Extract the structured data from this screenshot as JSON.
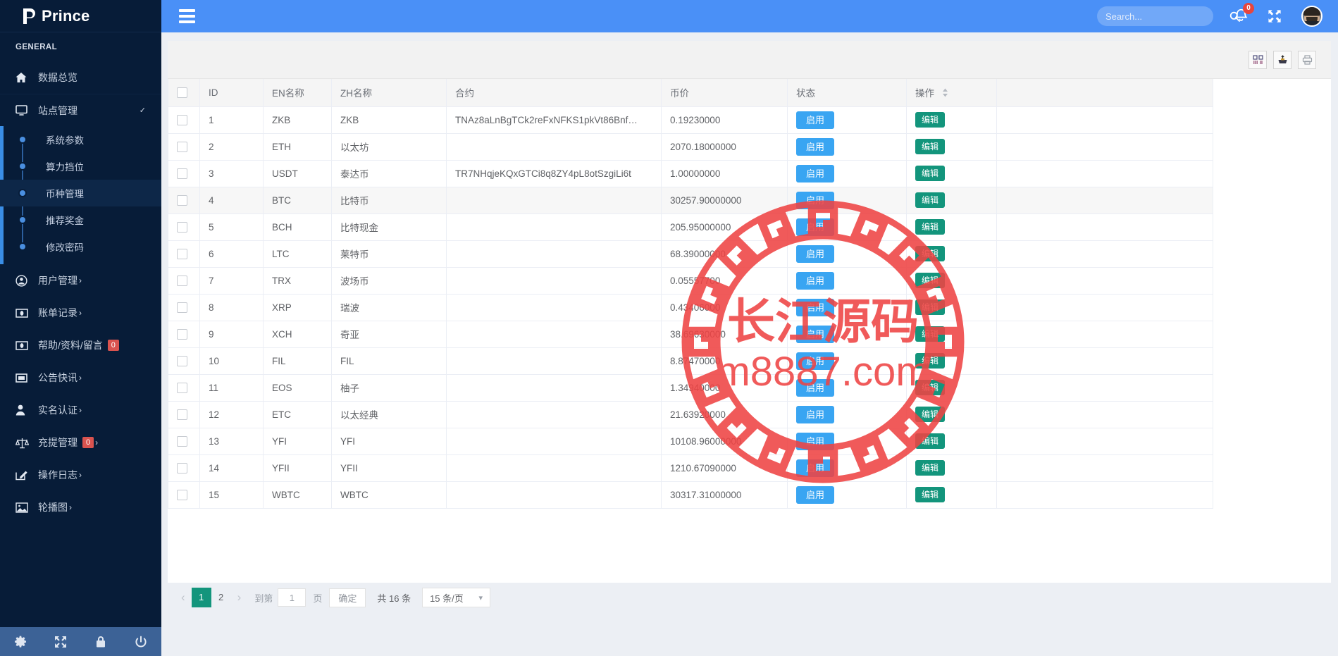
{
  "brand": {
    "name": "Prince",
    "logo_icon": "prince-p-logo"
  },
  "sidebar": {
    "section_label": "GENERAL",
    "items": [
      {
        "label": "数据总览",
        "icon": "home-icon",
        "arrow": "",
        "badge": null
      },
      {
        "label": "站点管理",
        "icon": "monitor-icon",
        "arrow": "chevron-down-icon",
        "badge": null
      }
    ],
    "submenu": [
      {
        "label": "系统参数",
        "active": false
      },
      {
        "label": "算力挡位",
        "active": false
      },
      {
        "label": "币种管理",
        "active": true
      },
      {
        "label": "推荐奖金",
        "active": false
      },
      {
        "label": "修改密码",
        "active": false
      }
    ],
    "items_after": [
      {
        "label": "用户管理",
        "icon": "user-circle-icon",
        "arrow": "›",
        "badge": null
      },
      {
        "label": "账单记录",
        "icon": "money-icon",
        "arrow": "›",
        "badge": null
      },
      {
        "label": "帮助/资料/留言",
        "icon": "money-icon",
        "arrow": "",
        "badge": "0"
      },
      {
        "label": "公告快讯",
        "icon": "window-icon",
        "arrow": "›",
        "badge": null
      },
      {
        "label": "实名认证",
        "icon": "person-icon",
        "arrow": "›",
        "badge": null
      },
      {
        "label": "充提管理",
        "icon": "scales-icon",
        "arrow": "›",
        "badge": "0"
      },
      {
        "label": "操作日志",
        "icon": "edit-square-icon",
        "arrow": "›",
        "badge": null
      },
      {
        "label": "轮播图",
        "icon": "image-icon",
        "arrow": "›",
        "badge": null
      }
    ],
    "footer_buttons": [
      {
        "name": "gear-icon"
      },
      {
        "name": "expand-icon"
      },
      {
        "name": "lock-icon"
      },
      {
        "name": "power-icon"
      }
    ]
  },
  "topbar": {
    "menu_toggle_icon": "hamburger-icon",
    "search_placeholder": "Search...",
    "search_value": "",
    "search_icon": "search-icon",
    "notification_icon": "bell-icon",
    "notification_count": "0",
    "fullscreen_icon": "expand-arrows-icon",
    "avatar_icon": "user-avatar"
  },
  "toolbar": {
    "buttons": [
      {
        "name": "columns-icon",
        "title": "列"
      },
      {
        "name": "export-icon",
        "title": "导出"
      },
      {
        "name": "print-icon",
        "title": "打印"
      }
    ]
  },
  "table": {
    "columns": [
      "",
      "ID",
      "EN名称",
      "ZH名称",
      "合约",
      "币价",
      "状态",
      "操作"
    ],
    "sort_column_index": 7,
    "enable_label": "启用",
    "edit_label": "编辑",
    "rows": [
      {
        "id": "1",
        "en": "ZKB",
        "zh": "ZKB",
        "contract": "TNAz8aLnBgTCk2reFxNFKS1pkVt86Bnf…",
        "price": "0.19230000",
        "status": "启用",
        "action": "编辑"
      },
      {
        "id": "2",
        "en": "ETH",
        "zh": "以太坊",
        "contract": "",
        "price": "2070.18000000",
        "status": "启用",
        "action": "编辑"
      },
      {
        "id": "3",
        "en": "USDT",
        "zh": "泰达币",
        "contract": "TR7NHqjeKQxGTCi8q8ZY4pL8otSzgiLi6t",
        "price": "1.00000000",
        "status": "启用",
        "action": "编辑"
      },
      {
        "id": "4",
        "en": "BTC",
        "zh": "比特币",
        "contract": "",
        "price": "30257.90000000",
        "status": "启用",
        "action": "编辑"
      },
      {
        "id": "5",
        "en": "BCH",
        "zh": "比特现金",
        "contract": "",
        "price": "205.95000000",
        "status": "启用",
        "action": "编辑"
      },
      {
        "id": "6",
        "en": "LTC",
        "zh": "莱特币",
        "contract": "",
        "price": "68.39000000",
        "status": "启用",
        "action": "编辑"
      },
      {
        "id": "7",
        "en": "TRX",
        "zh": "波场币",
        "contract": "",
        "price": "0.05557700",
        "status": "启用",
        "action": "编辑"
      },
      {
        "id": "8",
        "en": "XRP",
        "zh": "瑞波",
        "contract": "",
        "price": "0.43406000",
        "status": "启用",
        "action": "编辑"
      },
      {
        "id": "9",
        "en": "XCH",
        "zh": "奇亚",
        "contract": "",
        "price": "38.69630000",
        "status": "启用",
        "action": "编辑"
      },
      {
        "id": "10",
        "en": "FIL",
        "zh": "FIL",
        "contract": "",
        "price": "8.87470000",
        "status": "启用",
        "action": "编辑"
      },
      {
        "id": "11",
        "en": "EOS",
        "zh": "柚子",
        "contract": "",
        "price": "1.34940000",
        "status": "启用",
        "action": "编辑"
      },
      {
        "id": "12",
        "en": "ETC",
        "zh": "以太经典",
        "contract": "",
        "price": "21.63920000",
        "status": "启用",
        "action": "编辑"
      },
      {
        "id": "13",
        "en": "YFI",
        "zh": "YFI",
        "contract": "",
        "price": "10108.96000000",
        "status": "启用",
        "action": "编辑"
      },
      {
        "id": "14",
        "en": "YFII",
        "zh": "YFII",
        "contract": "",
        "price": "1210.67090000",
        "status": "启用",
        "action": "编辑"
      },
      {
        "id": "15",
        "en": "WBTC",
        "zh": "WBTC",
        "contract": "",
        "price": "30317.31000000",
        "status": "启用",
        "action": "编辑"
      }
    ]
  },
  "pagination": {
    "prev_icon": "chevron-left-icon",
    "next_icon": "chevron-right-icon",
    "pages": [
      "1",
      "2"
    ],
    "current_page": "1",
    "goto_label": "到第",
    "goto_value": "1",
    "page_unit": "页",
    "confirm_label": "确定",
    "total_label": "共 16 条",
    "page_size_label": "15 条/页"
  },
  "watermark": {
    "text_main": "长江源码",
    "text_sub": "m8887.com",
    "color": "#ef4444"
  },
  "colors": {
    "sidebar_bg": "#071c38",
    "topbar_blue": "#4a90f7",
    "enable_blue": "#39a5f2",
    "edit_green": "#13957c",
    "badge_red": "#d9534f",
    "page_bg": "#eceff4"
  }
}
